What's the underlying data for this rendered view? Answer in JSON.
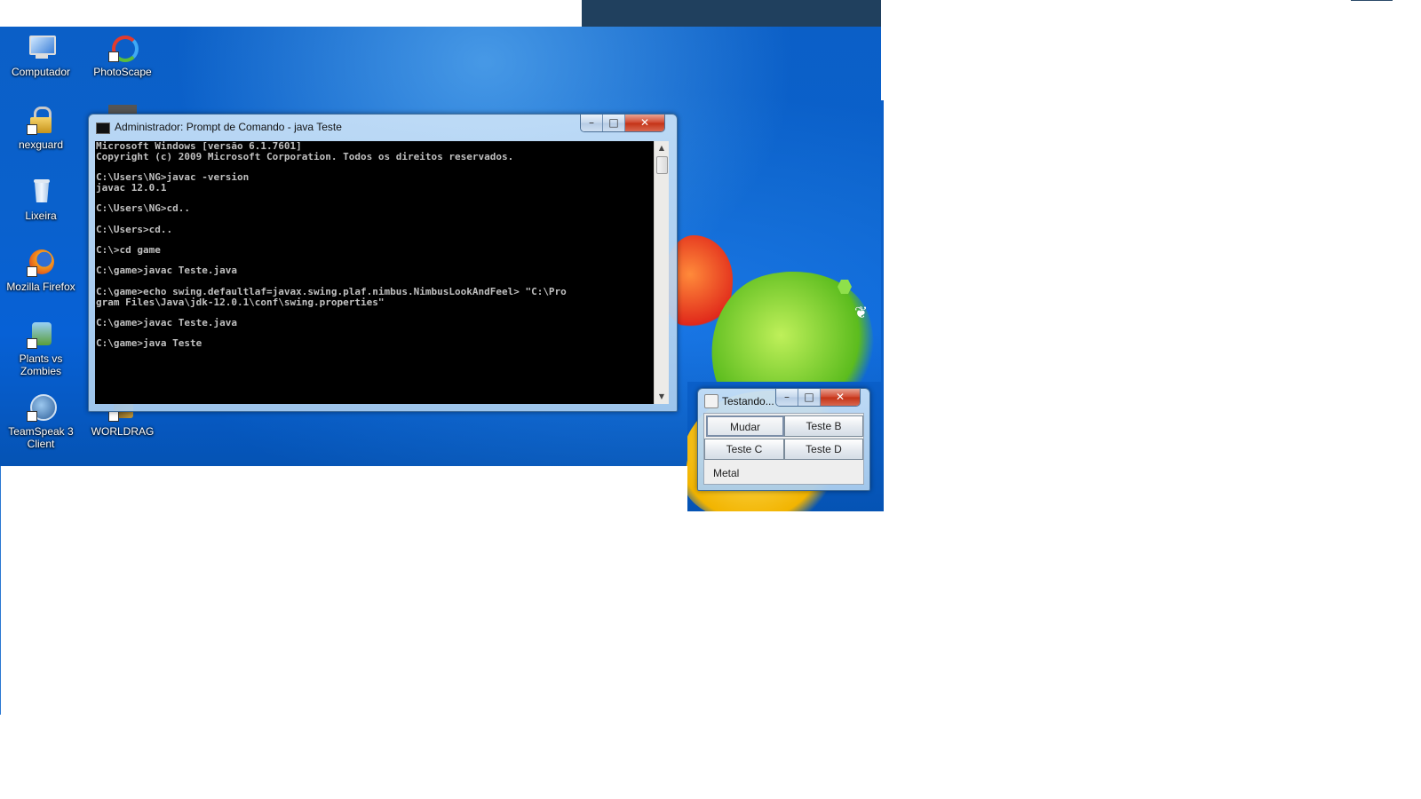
{
  "desktop": {
    "icons": [
      {
        "label": "Computador",
        "icon": "computer-icon"
      },
      {
        "label": "PhotoScape",
        "icon": "photoscape-icon"
      },
      {
        "label": "nexguard",
        "icon": "nexguard-icon"
      },
      {
        "label": "Lixeira",
        "icon": "recycle-bin-icon"
      },
      {
        "label": "Mozilla Firefox",
        "icon": "firefox-icon"
      },
      {
        "label": "Plants vs Zombies",
        "icon": "plants-vs-zombies-icon"
      },
      {
        "label": "TeamSpeak 3 Client",
        "icon": "teamspeak-icon"
      },
      {
        "label": "WORLDRAG",
        "icon": "worldrag-icon"
      }
    ]
  },
  "cmd": {
    "title": "Administrador: Prompt de Comando - java  Teste",
    "buttons": {
      "minimize": "–",
      "maximize": "□",
      "close": "✕"
    },
    "output": "Microsoft Windows [versão 6.1.7601]\nCopyright (c) 2009 Microsoft Corporation. Todos os direitos reservados.\n\nC:\\Users\\NG>javac -version\njavac 12.0.1\n\nC:\\Users\\NG>cd..\n\nC:\\Users>cd..\n\nC:\\>cd game\n\nC:\\game>javac Teste.java\n\nC:\\game>echo swing.defaultlaf=javax.swing.plaf.nimbus.NimbusLookAndFeel> \"C:\\Pro\ngram Files\\Java\\jdk-12.0.1\\conf\\swing.properties\"\n\nC:\\game>javac Teste.java\n\nC:\\game>java Teste"
  },
  "java_window": {
    "title": "Testando...",
    "buttons": {
      "minimize": "–",
      "maximize": "□",
      "close": "✕"
    },
    "button_labels": [
      "Mudar",
      "Teste B",
      "Teste C",
      "Teste D"
    ],
    "label": "Metal"
  },
  "colors": {
    "desktop_blue": "#0a61cc",
    "title_dark": "#20405e",
    "console_bg": "#000000",
    "console_text": "#c0c0c0",
    "close_red": "#c33216"
  }
}
